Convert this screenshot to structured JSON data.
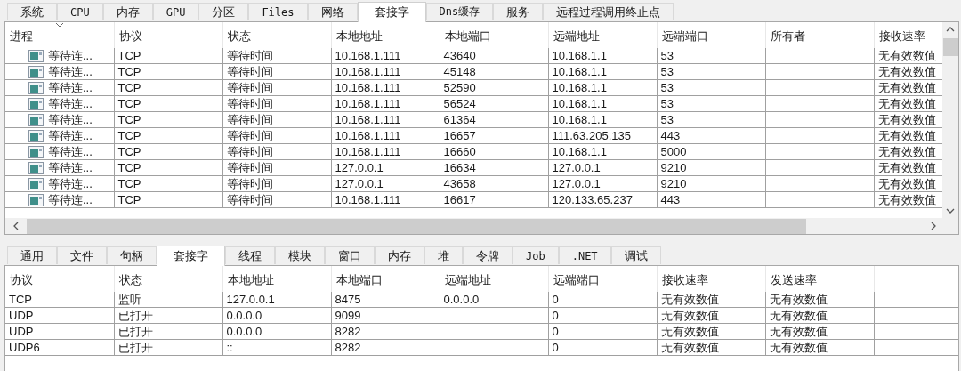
{
  "process_tabs": [
    {
      "label": "系统",
      "selected": false
    },
    {
      "label": "CPU",
      "selected": false
    },
    {
      "label": "内存",
      "selected": false
    },
    {
      "label": "GPU",
      "selected": false
    },
    {
      "label": "分区",
      "selected": false
    },
    {
      "label": "Files",
      "selected": false
    },
    {
      "label": "网络",
      "selected": false
    },
    {
      "label": "套接字",
      "selected": true
    },
    {
      "label": "Dns缓存",
      "selected": false
    },
    {
      "label": "服务",
      "selected": false
    },
    {
      "label": "远程过程调用终止点",
      "selected": false
    }
  ],
  "connections": {
    "columns": [
      "进程",
      "协议",
      "状态",
      "本地地址",
      "本地端口",
      "远端地址",
      "远端端口",
      "所有者",
      "接收速率"
    ],
    "rows": [
      {
        "process": "等待连...",
        "protocol": "TCP",
        "state": "等待时间",
        "local_address": "10.168.1.111",
        "local_port": "43640",
        "remote_address": "10.168.1.1",
        "remote_port": "53",
        "receive_rate": "无有效数值"
      },
      {
        "process": "等待连...",
        "protocol": "TCP",
        "state": "等待时间",
        "local_address": "10.168.1.111",
        "local_port": "45148",
        "remote_address": "10.168.1.1",
        "remote_port": "53",
        "receive_rate": "无有效数值"
      },
      {
        "process": "等待连...",
        "protocol": "TCP",
        "state": "等待时间",
        "local_address": "10.168.1.111",
        "local_port": "52590",
        "remote_address": "10.168.1.1",
        "remote_port": "53",
        "receive_rate": "无有效数值"
      },
      {
        "process": "等待连...",
        "protocol": "TCP",
        "state": "等待时间",
        "local_address": "10.168.1.111",
        "local_port": "56524",
        "remote_address": "10.168.1.1",
        "remote_port": "53",
        "receive_rate": "无有效数值"
      },
      {
        "process": "等待连...",
        "protocol": "TCP",
        "state": "等待时间",
        "local_address": "10.168.1.111",
        "local_port": "61364",
        "remote_address": "10.168.1.1",
        "remote_port": "53",
        "receive_rate": "无有效数值"
      },
      {
        "process": "等待连...",
        "protocol": "TCP",
        "state": "等待时间",
        "local_address": "10.168.1.111",
        "local_port": "16657",
        "remote_address": "111.63.205.135",
        "remote_port": "443",
        "receive_rate": "无有效数值"
      },
      {
        "process": "等待连...",
        "protocol": "TCP",
        "state": "等待时间",
        "local_address": "10.168.1.111",
        "local_port": "16660",
        "remote_address": "10.168.1.1",
        "remote_port": "5000",
        "receive_rate": "无有效数值"
      },
      {
        "process": "等待连...",
        "protocol": "TCP",
        "state": "等待时间",
        "local_address": "127.0.0.1",
        "local_port": "16634",
        "remote_address": "127.0.0.1",
        "remote_port": "9210",
        "receive_rate": "无有效数值"
      },
      {
        "process": "等待连...",
        "protocol": "TCP",
        "state": "等待时间",
        "local_address": "127.0.0.1",
        "local_port": "43658",
        "remote_address": "127.0.0.1",
        "remote_port": "9210",
        "receive_rate": "无有效数值"
      },
      {
        "process": "等待连...",
        "protocol": "TCP",
        "state": "等待时间",
        "local_address": "10.168.1.111",
        "local_port": "16617",
        "remote_address": "120.133.65.237",
        "remote_port": "443",
        "receive_rate": "无有效数值"
      }
    ]
  },
  "detail_tabs": [
    {
      "label": "通用",
      "selected": false
    },
    {
      "label": "文件",
      "selected": false
    },
    {
      "label": "句柄",
      "selected": false
    },
    {
      "label": "套接字",
      "selected": true
    },
    {
      "label": "线程",
      "selected": false
    },
    {
      "label": "模块",
      "selected": false
    },
    {
      "label": "窗口",
      "selected": false
    },
    {
      "label": "内存",
      "selected": false
    },
    {
      "label": "堆",
      "selected": false
    },
    {
      "label": "令牌",
      "selected": false
    },
    {
      "label": "Job",
      "selected": false
    },
    {
      "label": ".NET",
      "selected": false
    },
    {
      "label": "调试",
      "selected": false
    }
  ],
  "sockets": {
    "columns": [
      "协议",
      "状态",
      "本地地址",
      "本地端口",
      "远端地址",
      "远端端口",
      "接收速率",
      "发送速率"
    ],
    "rows": [
      {
        "protocol": "TCP",
        "state": "监听",
        "local_address": "127.0.0.1",
        "local_port": "8475",
        "remote_address": "0.0.0.0",
        "remote_port": "0",
        "receive_rate": "无有效数值",
        "send_rate": "无有效数值"
      },
      {
        "protocol": "UDP",
        "state": "已打开",
        "local_address": "0.0.0.0",
        "local_port": "9099",
        "remote_port": "0",
        "receive_rate": "无有效数值",
        "send_rate": "无有效数值"
      },
      {
        "protocol": "UDP",
        "state": "已打开",
        "local_address": "0.0.0.0",
        "local_port": "8282",
        "remote_port": "0",
        "receive_rate": "无有效数值",
        "send_rate": "无有效数值"
      },
      {
        "protocol": "UDP6",
        "state": "已打开",
        "local_address": "::",
        "local_port": "8282",
        "remote_port": "0",
        "receive_rate": "无有效数值",
        "send_rate": "无有效数值"
      }
    ]
  }
}
